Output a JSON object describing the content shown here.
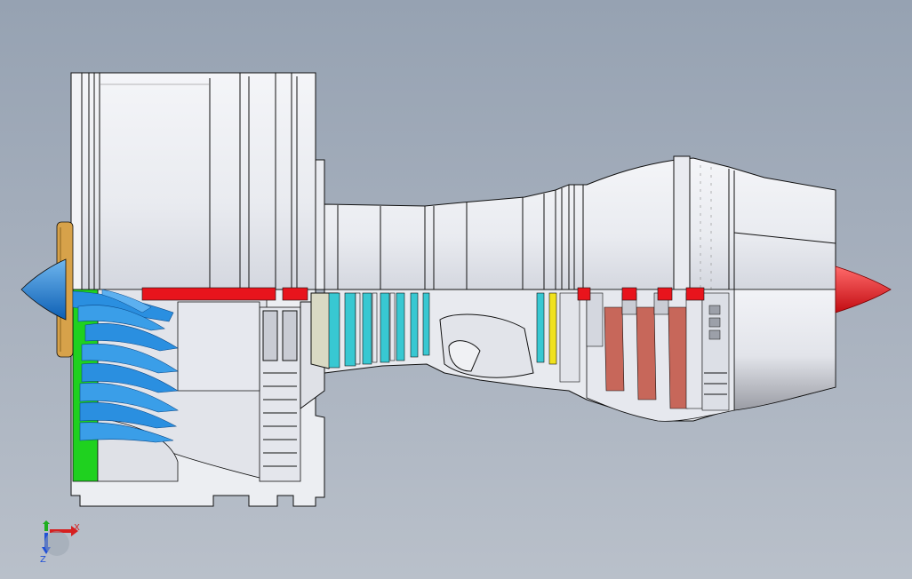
{
  "viewport": {
    "background_top": "#96a2b2",
    "background_bottom": "#b9c0ca"
  },
  "model": {
    "casing_color": "#eceef3",
    "section_color": "#e6e8ee",
    "outline_color": "#111111",
    "shaft_color": "#e8141c",
    "spinner_color": "#1a7fd6",
    "fan_blade_color": "#2a8fe0",
    "fan_hub_color": "#1fd11f",
    "spinner_ring_color": "#d7a24a",
    "lp_compressor_color": "#e0e2e8",
    "hp_compressor_color": "#38c8d2",
    "combustor_color": "#d9d9c4",
    "hp_turbine_color": "#f0e21e",
    "lp_turbine_color": "#c7675a",
    "exhaust_cone_color": "#e8141c"
  },
  "triad": {
    "x_label": "X",
    "z_label": "Z",
    "x_color": "#d62020",
    "y_color": "#1fae1f",
    "z_color": "#2050d6"
  }
}
